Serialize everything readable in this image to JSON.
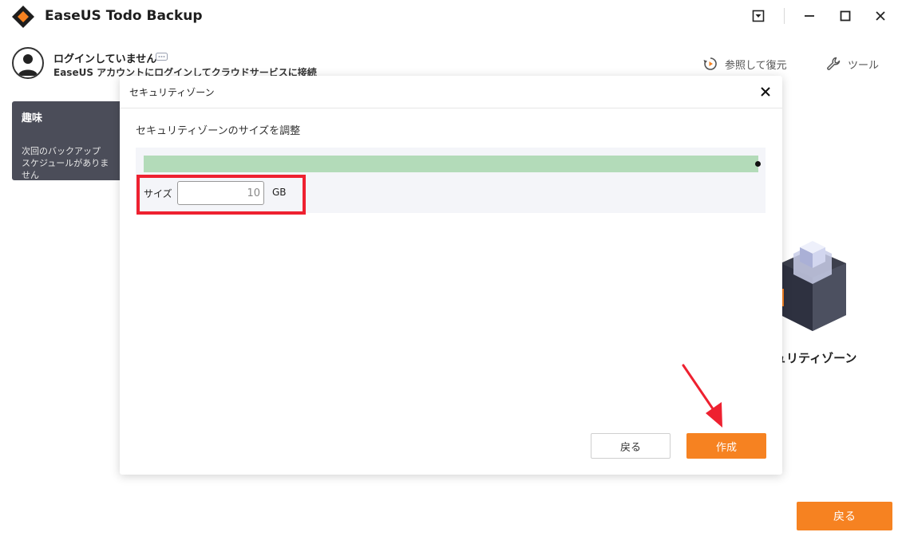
{
  "app": {
    "title": "EaseUS Todo Backup"
  },
  "account": {
    "status": "ログインしていません",
    "subtitle": "EaseUS アカウントにログインしてクラウドサービスに接続"
  },
  "top_actions": [
    {
      "label": "参照して復元",
      "icon": "restore-icon"
    },
    {
      "label": "ツール",
      "icon": "wrench-icon"
    }
  ],
  "hobby_card": {
    "title": "趣味",
    "text_line1": "次回のバックアップ",
    "text_line2": "スケジュールがありません"
  },
  "background": {
    "zone_label": "ュリティゾーン",
    "back_label": "戻る"
  },
  "dialog": {
    "title": "セキュリティゾーン",
    "subtitle": "セキュリティゾーンのサイズを調整",
    "size_label": "サイズ",
    "size_value": "10",
    "unit": "GB",
    "slider_fraction": 1.0,
    "back_label": "戻る",
    "create_label": "作成"
  },
  "colors": {
    "accent": "#f68221",
    "slider_fill": "#b3dbb9",
    "highlight": "#ee2130",
    "card_bg": "#4b4d59"
  }
}
